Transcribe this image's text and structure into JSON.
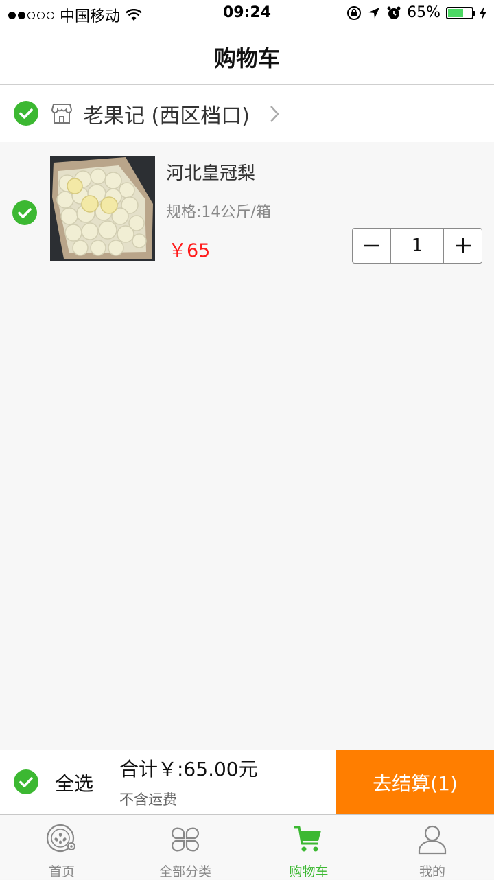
{
  "status_bar": {
    "carrier": "中国移动",
    "time": "09:24",
    "battery": "65%",
    "battery_level": 0.65,
    "battery_color": "#4cd964"
  },
  "nav": {
    "title": "购物车"
  },
  "store": {
    "name": "老果记 (西区档口)",
    "selected": true,
    "icon": "store-icon"
  },
  "items": [
    {
      "name": "河北皇冠梨",
      "spec": "规格:14公斤/箱",
      "price": "￥65",
      "quantity": "1",
      "selected": true
    }
  ],
  "checkout": {
    "select_all": "全选",
    "total": "合计￥:65.00元",
    "shipping_note": "不含运费",
    "pay_button": "去结算(1)",
    "pay_color": "#ff7e00"
  },
  "tabs": [
    {
      "label": "首页",
      "icon": "home-icon",
      "active": false
    },
    {
      "label": "全部分类",
      "icon": "categories-icon",
      "active": false
    },
    {
      "label": "购物车",
      "icon": "cart-icon",
      "active": true
    },
    {
      "label": "我的",
      "icon": "profile-icon",
      "active": false
    }
  ],
  "accent_color": "#3cb832",
  "price_color": "#ff1a1a"
}
